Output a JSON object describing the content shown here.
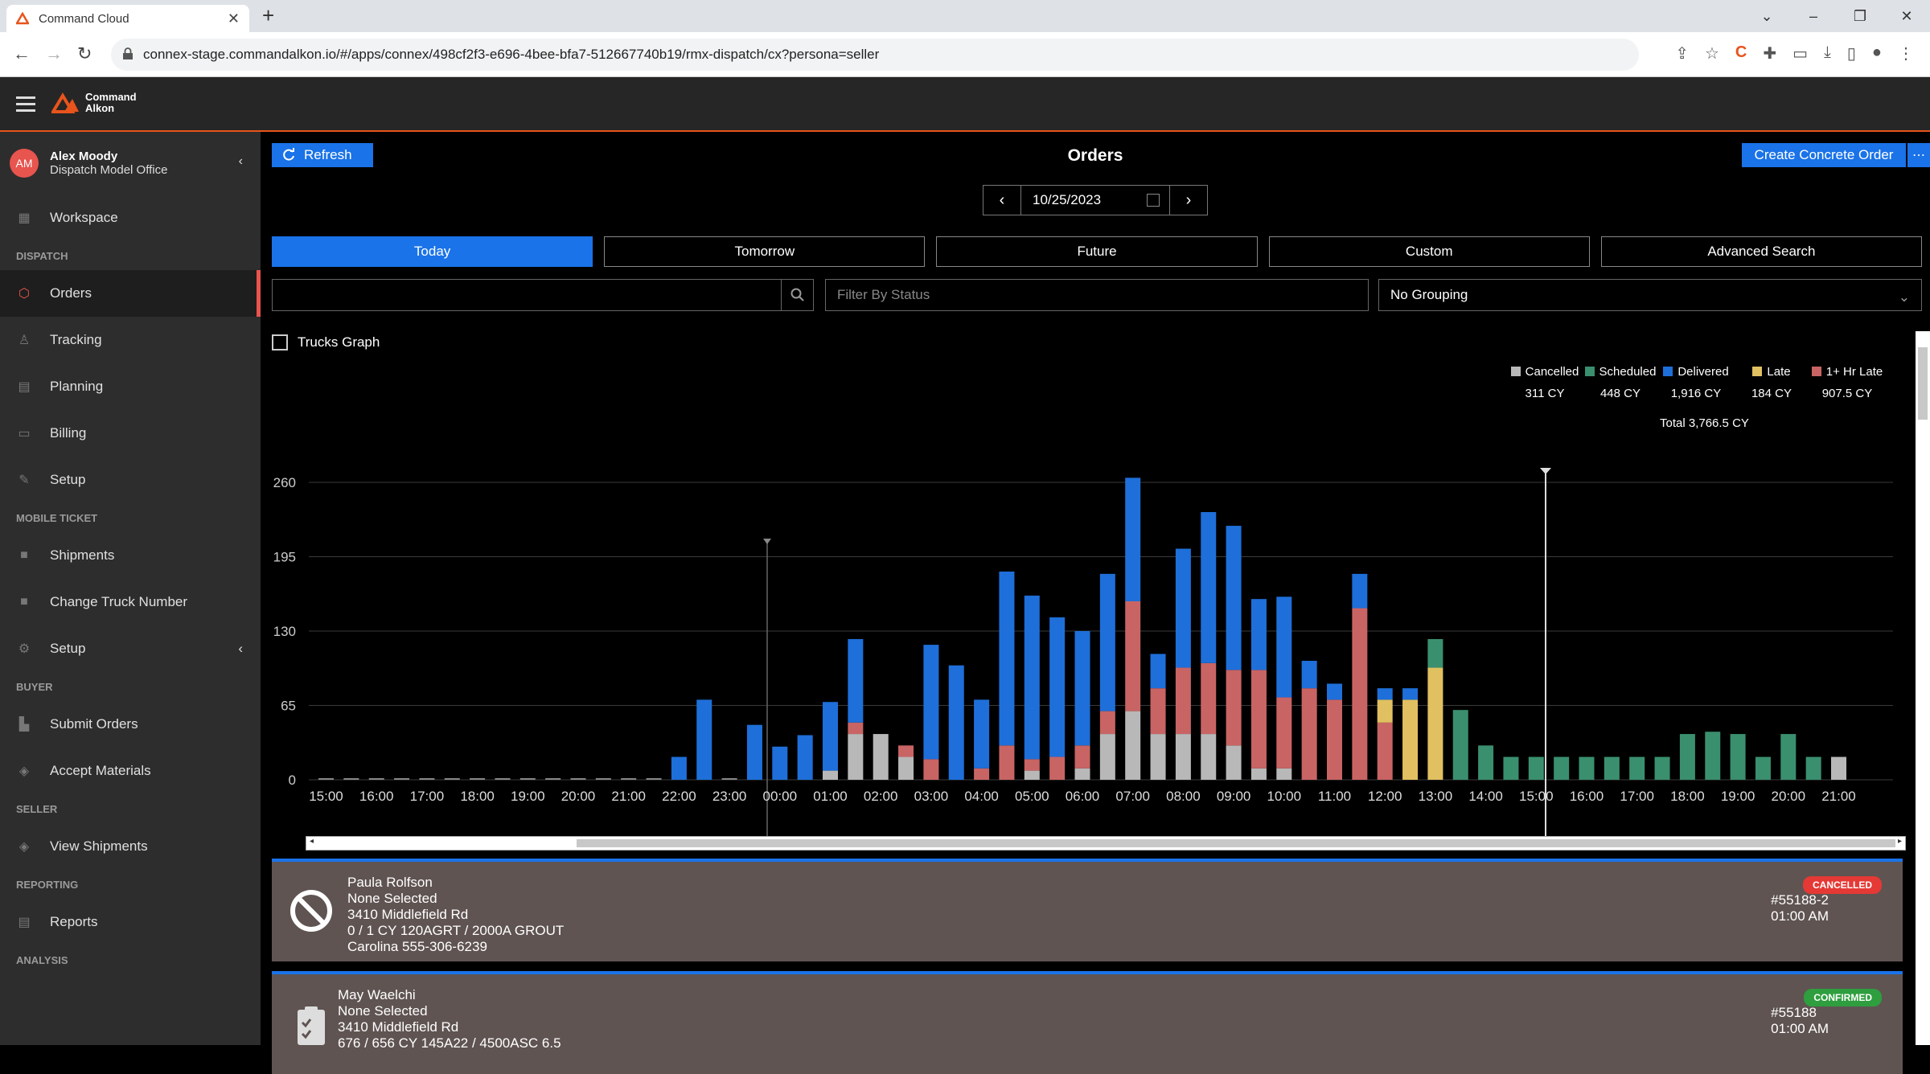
{
  "browser": {
    "tab_title": "Command Cloud",
    "url": "connex-stage.commandalkon.io/#/apps/connex/498cf2f3-e696-4bee-bfa7-512667740b19/rmx-dispatch/cx?persona=seller"
  },
  "app": {
    "brand_line1": "Command",
    "brand_line2": "Alkon",
    "accent": "#e8541c"
  },
  "user": {
    "initials": "AM",
    "name": "Alex Moody",
    "office": "Dispatch Model Office"
  },
  "sidebar": {
    "workspace": "Workspace",
    "sec_dispatch": "DISPATCH",
    "orders": "Orders",
    "tracking": "Tracking",
    "planning": "Planning",
    "billing": "Billing",
    "setup": "Setup",
    "sec_mobile": "MOBILE TICKET",
    "shipments": "Shipments",
    "change_truck": "Change Truck Number",
    "setup2": "Setup",
    "sec_buyer": "BUYER",
    "submit_orders": "Submit Orders",
    "accept_materials": "Accept Materials",
    "sec_seller": "SELLER",
    "view_shipments": "View Shipments",
    "sec_reporting": "REPORTING",
    "reports": "Reports",
    "sec_analysis": "ANALYSIS"
  },
  "toolbar": {
    "refresh": "Refresh",
    "title": "Orders",
    "create": "Create Concrete Order",
    "date": "10/25/2023"
  },
  "tabs": [
    "Today",
    "Tomorrow",
    "Future",
    "Custom",
    "Advanced Search"
  ],
  "filters": {
    "search_value": "",
    "status_placeholder": "Filter By Status",
    "grouping": "No Grouping"
  },
  "trucks_graph_label": "Trucks Graph",
  "chart_data": {
    "type": "bar",
    "stacked": true,
    "y_ticks": [
      0,
      65,
      130,
      195,
      260
    ],
    "ylim": [
      0,
      270
    ],
    "x_tick_labels": [
      "15:00",
      "16:00",
      "17:00",
      "18:00",
      "19:00",
      "20:00",
      "21:00",
      "22:00",
      "23:00",
      "00:00",
      "01:00",
      "02:00",
      "03:00",
      "04:00",
      "05:00",
      "06:00",
      "07:00",
      "08:00",
      "09:00",
      "10:00",
      "11:00",
      "12:00",
      "13:00",
      "14:00",
      "15:00",
      "16:00",
      "17:00",
      "18:00",
      "19:00",
      "20:00",
      "21:00"
    ],
    "legend": [
      {
        "name": "Cancelled",
        "total": "311 CY",
        "color": "#b8b8b8"
      },
      {
        "name": "Scheduled",
        "total": "448 CY",
        "color": "#3a8f6f"
      },
      {
        "name": "Delivered",
        "total": "1,916 CY",
        "color": "#1e6fd9"
      },
      {
        "name": "Late",
        "total": "184 CY",
        "color": "#e0c060"
      },
      {
        "name": "1+ Hr Late",
        "total": "907.5 CY",
        "color": "#c96464"
      }
    ],
    "total_label": "Total 3,766.5 CY",
    "bars": [
      {
        "c": 0,
        "s": 0,
        "d": 0,
        "l": 0,
        "h": 0
      },
      {
        "c": 0,
        "s": 0,
        "d": 0,
        "l": 0,
        "h": 0
      },
      {
        "c": 0,
        "s": 0,
        "d": 0,
        "l": 0,
        "h": 0
      },
      {
        "c": 0,
        "s": 0,
        "d": 0,
        "l": 0,
        "h": 0
      },
      {
        "c": 0,
        "s": 0,
        "d": 0,
        "l": 0,
        "h": 0
      },
      {
        "c": 0,
        "s": 0,
        "d": 0,
        "l": 0,
        "h": 0
      },
      {
        "c": 0,
        "s": 0,
        "d": 0,
        "l": 0,
        "h": 0
      },
      {
        "c": 0,
        "s": 0,
        "d": 0,
        "l": 0,
        "h": 0
      },
      {
        "c": 0,
        "s": 0,
        "d": 0,
        "l": 0,
        "h": 0
      },
      {
        "c": 0,
        "s": 0,
        "d": 0,
        "l": 0,
        "h": 0
      },
      {
        "c": 0,
        "s": 0,
        "d": 0,
        "l": 0,
        "h": 0
      },
      {
        "c": 0,
        "s": 0,
        "d": 0,
        "l": 0,
        "h": 0
      },
      {
        "c": 0,
        "s": 0,
        "d": 0,
        "l": 0,
        "h": 0
      },
      {
        "c": 0,
        "s": 0,
        "d": 0,
        "l": 0,
        "h": 0
      },
      {
        "c": 0,
        "s": 0,
        "d": 20,
        "l": 0,
        "h": 0
      },
      {
        "c": 0,
        "s": 0,
        "d": 70,
        "l": 0,
        "h": 0
      },
      {
        "c": 0,
        "s": 0,
        "d": 0,
        "l": 0,
        "h": 0
      },
      {
        "c": 0,
        "s": 0,
        "d": 48,
        "l": 0,
        "h": 0
      },
      {
        "c": 0,
        "s": 0,
        "d": 29,
        "l": 0,
        "h": 0
      },
      {
        "c": 0,
        "s": 0,
        "d": 39,
        "l": 0,
        "h": 0
      },
      {
        "c": 8,
        "s": 0,
        "d": 60,
        "l": 0,
        "h": 0
      },
      {
        "c": 40,
        "s": 0,
        "d": 73,
        "l": 0,
        "h": 10
      },
      {
        "c": 40,
        "s": 0,
        "d": 0,
        "l": 0,
        "h": 0
      },
      {
        "c": 20,
        "s": 0,
        "d": 0,
        "l": 0,
        "h": 10
      },
      {
        "c": 0,
        "s": 0,
        "d": 100,
        "l": 0,
        "h": 18
      },
      {
        "c": 0,
        "s": 0,
        "d": 100,
        "l": 0,
        "h": 0
      },
      {
        "c": 0,
        "s": 0,
        "d": 60,
        "l": 0,
        "h": 10
      },
      {
        "c": 0,
        "s": 0,
        "d": 152,
        "l": 0,
        "h": 30
      },
      {
        "c": 8,
        "s": 0,
        "d": 143,
        "l": 0,
        "h": 10
      },
      {
        "c": 0,
        "s": 0,
        "d": 122,
        "l": 0,
        "h": 20
      },
      {
        "c": 10,
        "s": 0,
        "d": 100,
        "l": 0,
        "h": 20
      },
      {
        "c": 40,
        "s": 0,
        "d": 120,
        "l": 0,
        "h": 20
      },
      {
        "c": 60,
        "s": 0,
        "d": 108,
        "l": 0,
        "h": 96
      },
      {
        "c": 40,
        "s": 0,
        "d": 30,
        "l": 0,
        "h": 40
      },
      {
        "c": 40,
        "s": 0,
        "d": 104,
        "l": 0,
        "h": 58
      },
      {
        "c": 40,
        "s": 0,
        "d": 132,
        "l": 0,
        "h": 62
      },
      {
        "c": 30,
        "s": 0,
        "d": 126,
        "l": 0,
        "h": 66
      },
      {
        "c": 10,
        "s": 0,
        "d": 62,
        "l": 0,
        "h": 86
      },
      {
        "c": 10,
        "s": 0,
        "d": 88,
        "l": 0,
        "h": 62
      },
      {
        "c": 0,
        "s": 0,
        "d": 24,
        "l": 0,
        "h": 80
      },
      {
        "c": 0,
        "s": 0,
        "d": 14,
        "l": 0,
        "h": 70
      },
      {
        "c": 0,
        "s": 0,
        "d": 30,
        "l": 0,
        "h": 150
      },
      {
        "c": 0,
        "s": 0,
        "d": 10,
        "l": 20,
        "h": 50
      },
      {
        "c": 0,
        "s": 0,
        "d": 10,
        "l": 70,
        "h": 0
      },
      {
        "c": 0,
        "s": 25,
        "d": 0,
        "l": 98,
        "h": 0
      },
      {
        "c": 0,
        "s": 61,
        "d": 0,
        "l": 0,
        "h": 0
      },
      {
        "c": 0,
        "s": 30,
        "d": 0,
        "l": 0,
        "h": 0
      },
      {
        "c": 0,
        "s": 20,
        "d": 0,
        "l": 0,
        "h": 0
      },
      {
        "c": 0,
        "s": 20,
        "d": 0,
        "l": 0,
        "h": 0
      },
      {
        "c": 0,
        "s": 20,
        "d": 0,
        "l": 0,
        "h": 0
      },
      {
        "c": 0,
        "s": 20,
        "d": 0,
        "l": 0,
        "h": 0
      },
      {
        "c": 0,
        "s": 20,
        "d": 0,
        "l": 0,
        "h": 0
      },
      {
        "c": 0,
        "s": 20,
        "d": 0,
        "l": 0,
        "h": 0
      },
      {
        "c": 0,
        "s": 20,
        "d": 0,
        "l": 0,
        "h": 0
      },
      {
        "c": 0,
        "s": 40,
        "d": 0,
        "l": 0,
        "h": 0
      },
      {
        "c": 0,
        "s": 42,
        "d": 0,
        "l": 0,
        "h": 0
      },
      {
        "c": 0,
        "s": 40,
        "d": 0,
        "l": 0,
        "h": 0
      },
      {
        "c": 0,
        "s": 20,
        "d": 0,
        "l": 0,
        "h": 0
      },
      {
        "c": 0,
        "s": 40,
        "d": 0,
        "l": 0,
        "h": 0
      },
      {
        "c": 0,
        "s": 20,
        "d": 0,
        "l": 0,
        "h": 0
      },
      {
        "c": 20,
        "s": 0,
        "d": 0,
        "l": 0,
        "h": 0
      }
    ]
  },
  "orders": [
    {
      "customer": "Paula Rolfson",
      "project": "None Selected",
      "address": "3410 Middlefield Rd",
      "product": "0 / 1 CY 120AGRT / 2000A GROUT",
      "contact": "Carolina 555-306-6239",
      "status": "CANCELLED",
      "status_color": "#e53935",
      "number": "#55188-2",
      "time": "01:00 AM"
    },
    {
      "customer": "May Waelchi",
      "project": "None Selected",
      "address": "3410 Middlefield Rd",
      "product": "676 / 656 CY 145A22 / 4500ASC 6.5",
      "status": "CONFIRMED",
      "status_color": "#2e9e3e",
      "number": "#55188",
      "time": "01:00 AM"
    }
  ]
}
